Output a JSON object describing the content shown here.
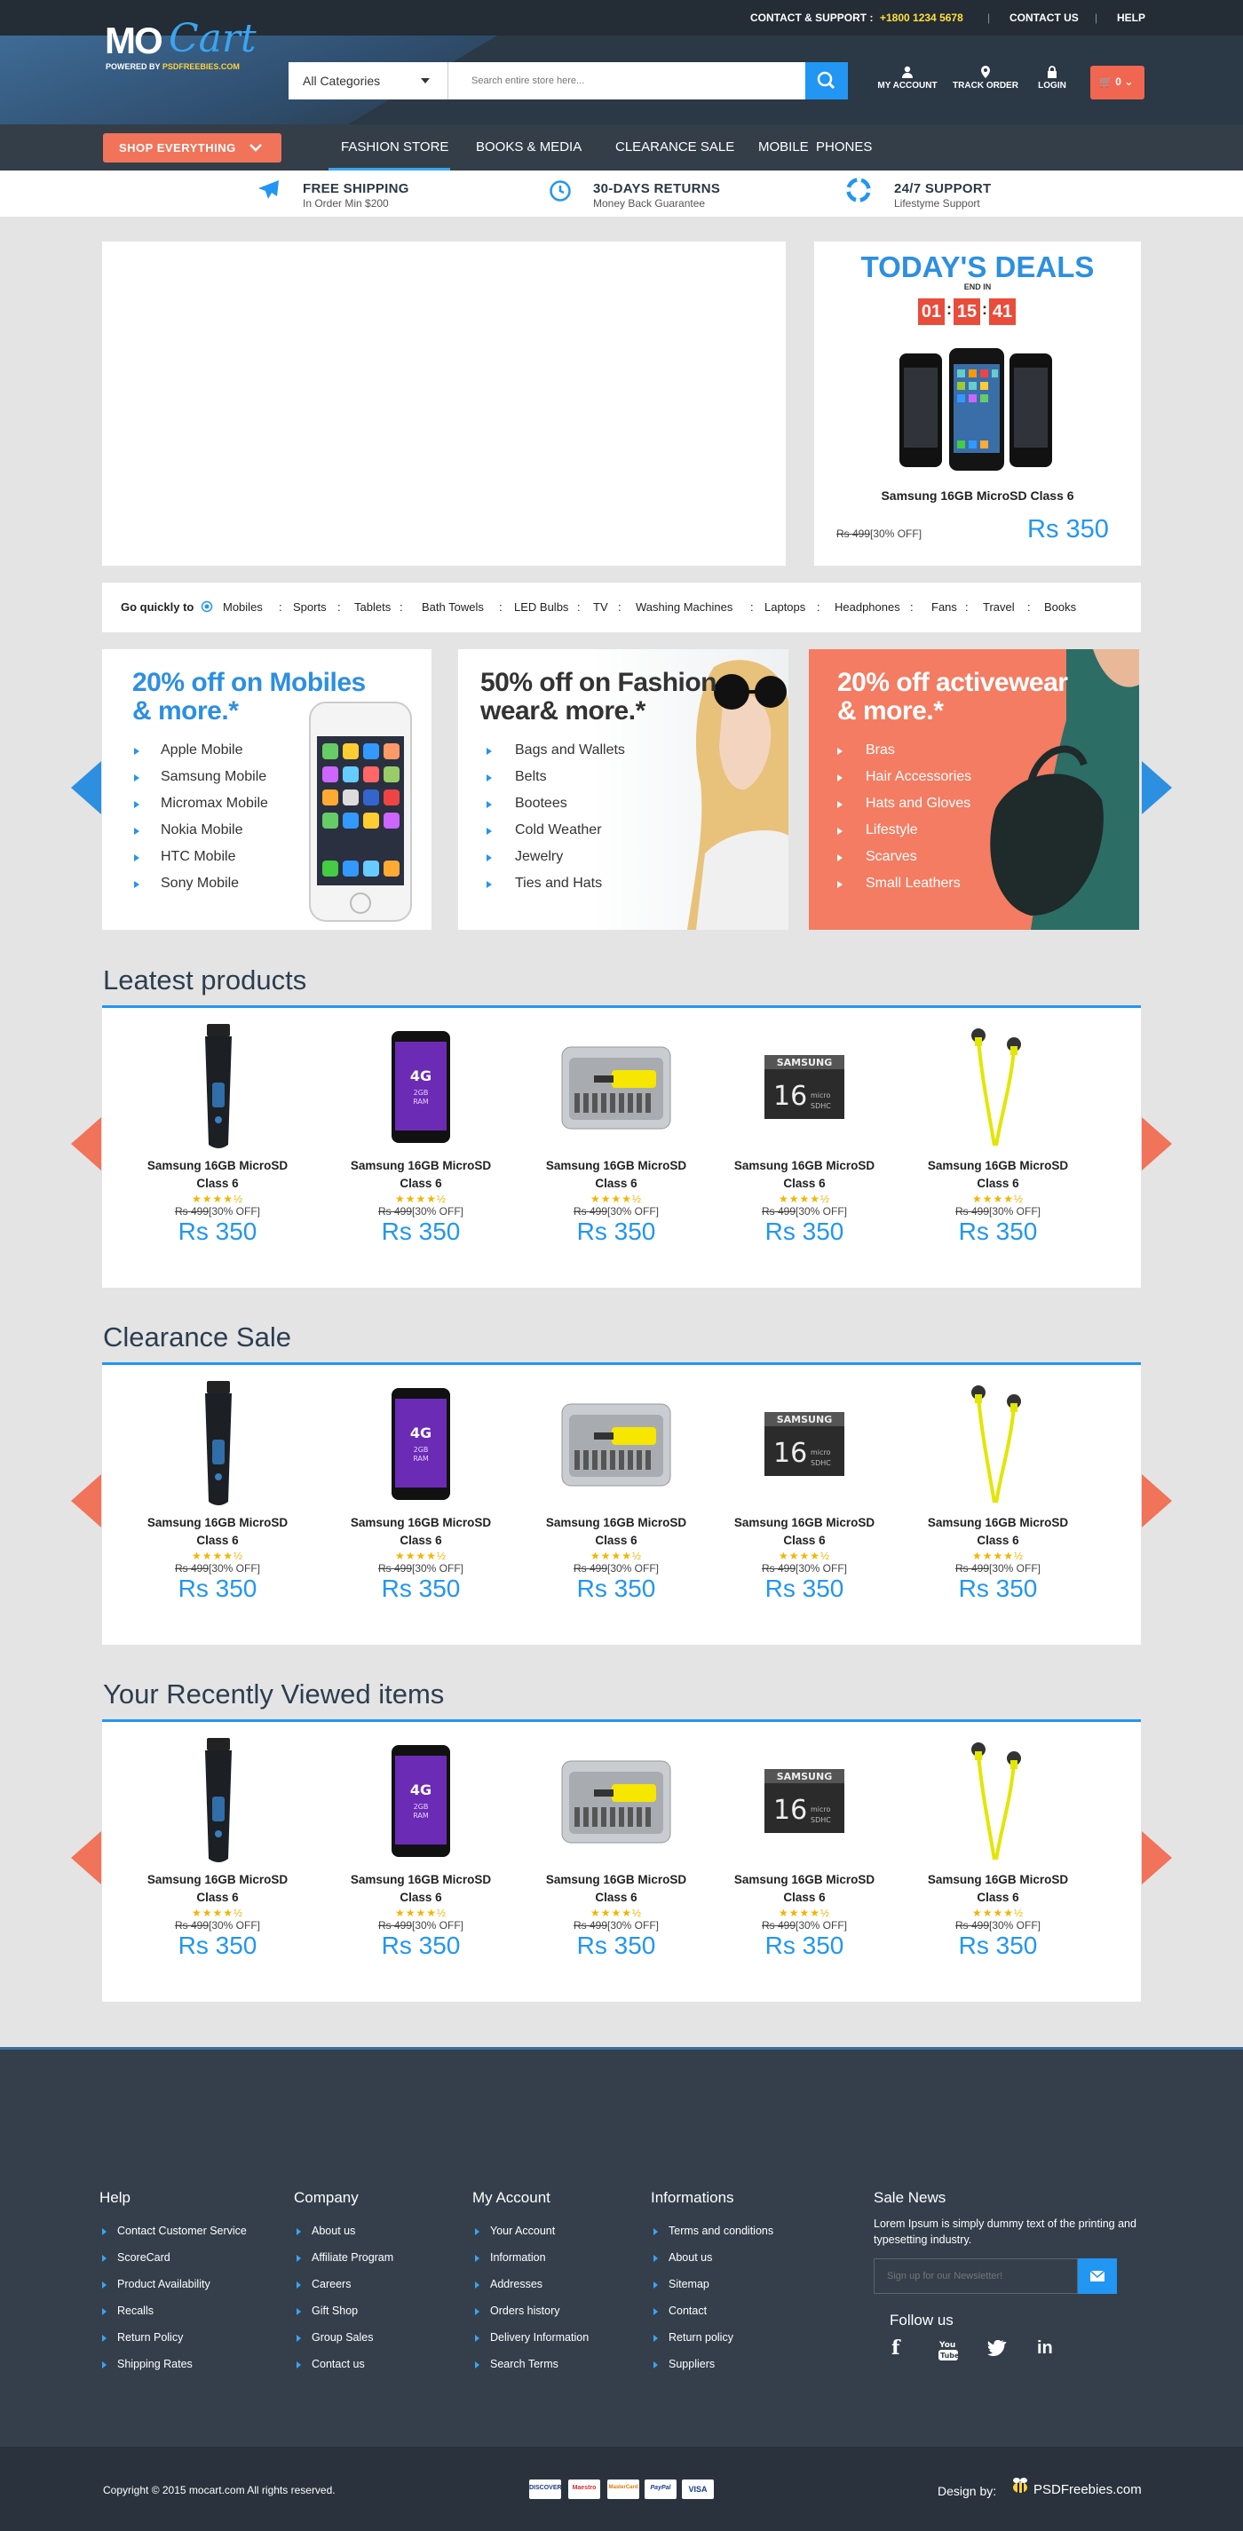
{
  "topbar": {
    "contact_label": "CONTACT & SUPPORT :",
    "phone": "+1800 1234 5678",
    "contact_us": "CONTACT US",
    "help": "HELP"
  },
  "logo": {
    "mo": "MO",
    "cart": "Cart",
    "powered_prefix": "POWERED BY",
    "powered_site": "PSDFREEBIES.COM"
  },
  "search": {
    "category": "All Categories",
    "placeholder": "Search entire store here..."
  },
  "header_icons": {
    "account": "MY ACCOUNT",
    "track": "TRACK ORDER",
    "login": "LOGIN",
    "cart_count": "0"
  },
  "nav": {
    "shop": "SHOP EVERYTHING",
    "items": [
      "FASHION STORE",
      "BOOKS & MEDIA",
      "CLEARANCE SALE",
      "MOBILE  PHONES"
    ]
  },
  "features": [
    {
      "title": "FREE SHIPPING",
      "sub": "In Order Min $200",
      "icon": "plane-icon"
    },
    {
      "title": "30-DAYS RETURNS",
      "sub": "Money Back  Guarantee",
      "icon": "clock-icon"
    },
    {
      "title": "24/7 SUPPORT",
      "sub": "Lifestyme Support",
      "icon": "lifebuoy-icon"
    }
  ],
  "deals": {
    "title": "TODAY'S DEALS",
    "end_in": "END IN",
    "hours": "01",
    "minutes": "15",
    "seconds": "41",
    "product": "Samsung 16GB MicroSD Class 6",
    "old_price": "Rs 499",
    "discount": "[30% OFF]",
    "price": "Rs 350"
  },
  "quick": {
    "label": "Go quickly to",
    "links": [
      "Mobiles",
      "Sports",
      "Tablets",
      "Bath Towels",
      "LED Bulbs",
      "TV",
      "Washing Machines",
      "Laptops",
      "Headphones",
      "Fans",
      "Travel",
      "Books"
    ]
  },
  "promos": [
    {
      "title1": "20% off on Mobiles",
      "title2": "& more.*",
      "items": [
        "Apple Mobile",
        "Samsung Mobile",
        "Micromax Mobile",
        "Nokia Mobile",
        "HTC Mobile",
        "Sony Mobile"
      ]
    },
    {
      "title1": "50% off on Fashion",
      "title2": "wear& more.*",
      "items": [
        "Bags and Wallets",
        "Belts",
        "Bootees",
        "Cold Weather",
        "Jewelry",
        "Ties and Hats"
      ]
    },
    {
      "title1": "20% off activewear",
      "title2": "& more.*",
      "items": [
        "Bras",
        "Hair Accessories",
        "Hats and Gloves",
        "Lifestyle",
        "Scarves",
        "Small Leathers"
      ]
    }
  ],
  "sections": [
    {
      "title": "Leatest products"
    },
    {
      "title": "Clearance Sale"
    },
    {
      "title": "Your Recently Viewed items"
    }
  ],
  "product": {
    "name_line1": "Samsung 16GB MicroSD",
    "name_line2": "Class 6",
    "stars": "★★★★½",
    "old_price": "Rs 499",
    "discount": "[30% OFF]",
    "price": "Rs 350",
    "rating": 4.5
  },
  "product_images": [
    "trimmer",
    "phone",
    "toolkit",
    "sdcard",
    "earphones"
  ],
  "footer": {
    "help": {
      "title": "Help",
      "items": [
        "Contact Customer Service",
        "ScoreCard",
        "Product Availability",
        "Recalls",
        "Return Policy",
        "Shipping Rates"
      ]
    },
    "company": {
      "title": "Company",
      "items": [
        "About us",
        "Affiliate Program",
        "Careers",
        "Gift Shop",
        "Group Sales",
        "Contact us"
      ]
    },
    "account": {
      "title": "My Account",
      "items": [
        "Your Account",
        "Information",
        "Addresses",
        "Orders history",
        "Delivery Information",
        "Search Terms"
      ]
    },
    "info": {
      "title": "Informations",
      "items": [
        "Terms and conditions",
        "About us",
        "Sitemap",
        "Contact",
        "Return policy",
        "Suppliers"
      ]
    },
    "news": {
      "title": "Sale News",
      "text": "Lorem Ipsum is simply dummy text of the printing and typesetting industry.",
      "placeholder": "Sign up for our Newsletter!",
      "follow": "Follow us"
    }
  },
  "bottom": {
    "copyright": "Copyright © 2015 mocart.com All rights reserved.",
    "design_by": "Design by:",
    "psd": "PSDFreebies.com",
    "cards": [
      "DISCOVER",
      "Maestro",
      "MasterCard",
      "PayPal",
      "VISA"
    ]
  },
  "colors": {
    "accent": "#2196f3",
    "coral": "#f0735a",
    "dark": "#2b3845",
    "countdown": "#e94c3b",
    "star": "#f4b400"
  }
}
